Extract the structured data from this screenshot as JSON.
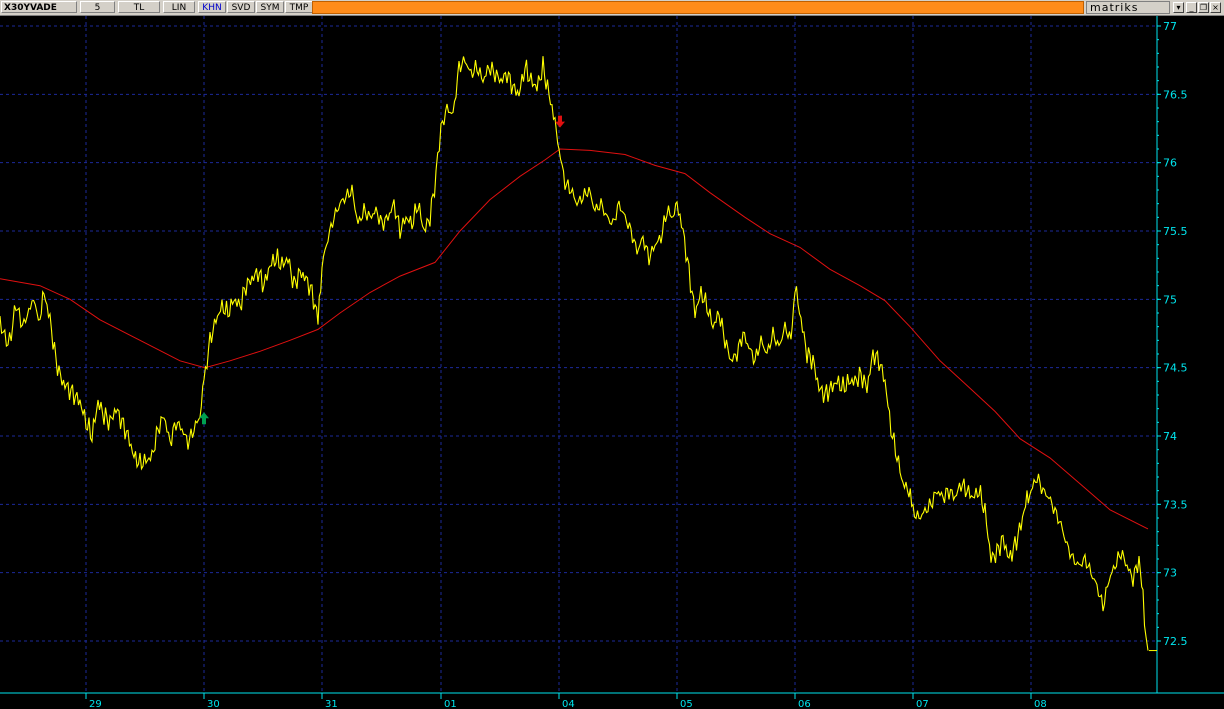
{
  "toolbar": {
    "symbol": "X30YVADE",
    "period": "5",
    "currency": "TL",
    "scale": "LIN",
    "khn": "KHN",
    "svd": "SVD",
    "sym": "SYM",
    "tmp": "TMP",
    "brand": "matriks"
  },
  "window_controls": {
    "dropdown_icon": "chevron-down-icon",
    "minimize_icon": "minimize-icon",
    "restore_icon": "restore-icon",
    "close_icon": "close-icon"
  },
  "colors": {
    "background": "#000000",
    "grid": "#1c2a9a",
    "axis_text": "#00e5ee",
    "price_line": "#ffff00",
    "moving_average": "#e01010",
    "buy_arrow": "#00a050",
    "sell_arrow": "#e01010",
    "toolbar_accent": "#ff8c1a"
  },
  "chart_data": {
    "type": "line",
    "ylim": [
      72.2,
      77.1
    ],
    "yticks": [
      77,
      76.5,
      76,
      75.5,
      75,
      74.5,
      74,
      73.5,
      73,
      72.5
    ],
    "xlim": [
      0,
      1148
    ],
    "x_day_boundaries": [
      86,
      204,
      322,
      441,
      559,
      677,
      795,
      913,
      1031
    ],
    "x_tick_labels": [
      "29",
      "30",
      "31",
      "01",
      "04",
      "05",
      "06",
      "07",
      "08"
    ],
    "last_price": 72.43,
    "series": [
      {
        "type": "price",
        "points": [
          [
            0,
            74.85
          ],
          [
            8,
            74.65
          ],
          [
            16,
            74.95
          ],
          [
            24,
            74.8
          ],
          [
            32,
            75.0
          ],
          [
            40,
            74.85
          ],
          [
            44,
            75.05
          ],
          [
            50,
            74.85
          ],
          [
            56,
            74.55
          ],
          [
            62,
            74.4
          ],
          [
            68,
            74.35
          ],
          [
            74,
            74.3
          ],
          [
            80,
            74.25
          ],
          [
            86,
            74.1
          ],
          [
            92,
            74.0
          ],
          [
            98,
            74.25
          ],
          [
            104,
            74.15
          ],
          [
            110,
            74.1
          ],
          [
            116,
            74.2
          ],
          [
            122,
            74.1
          ],
          [
            128,
            74.0
          ],
          [
            134,
            73.85
          ],
          [
            140,
            73.8
          ],
          [
            146,
            73.82
          ],
          [
            152,
            73.85
          ],
          [
            158,
            74.05
          ],
          [
            164,
            74.15
          ],
          [
            170,
            73.95
          ],
          [
            176,
            74.1
          ],
          [
            182,
            74.05
          ],
          [
            188,
            73.95
          ],
          [
            194,
            74.05
          ],
          [
            200,
            74.15
          ],
          [
            204,
            74.4
          ],
          [
            210,
            74.7
          ],
          [
            216,
            74.85
          ],
          [
            222,
            74.95
          ],
          [
            228,
            74.9
          ],
          [
            234,
            75.0
          ],
          [
            240,
            74.95
          ],
          [
            246,
            75.1
          ],
          [
            252,
            75.15
          ],
          [
            258,
            75.2
          ],
          [
            264,
            75.1
          ],
          [
            270,
            75.25
          ],
          [
            276,
            75.3
          ],
          [
            282,
            75.25
          ],
          [
            288,
            75.3
          ],
          [
            294,
            75.1
          ],
          [
            300,
            75.2
          ],
          [
            306,
            75.15
          ],
          [
            312,
            75.05
          ],
          [
            318,
            74.85
          ],
          [
            322,
            75.25
          ],
          [
            328,
            75.45
          ],
          [
            334,
            75.6
          ],
          [
            340,
            75.7
          ],
          [
            346,
            75.75
          ],
          [
            352,
            75.8
          ],
          [
            358,
            75.55
          ],
          [
            364,
            75.65
          ],
          [
            370,
            75.6
          ],
          [
            376,
            75.65
          ],
          [
            382,
            75.55
          ],
          [
            388,
            75.6
          ],
          [
            394,
            75.7
          ],
          [
            400,
            75.5
          ],
          [
            406,
            75.6
          ],
          [
            412,
            75.55
          ],
          [
            418,
            75.7
          ],
          [
            424,
            75.5
          ],
          [
            430,
            75.6
          ],
          [
            436,
            75.9
          ],
          [
            441,
            76.25
          ],
          [
            447,
            76.4
          ],
          [
            453,
            76.35
          ],
          [
            459,
            76.7
          ],
          [
            465,
            76.75
          ],
          [
            471,
            76.65
          ],
          [
            477,
            76.7
          ],
          [
            483,
            76.6
          ],
          [
            489,
            76.7
          ],
          [
            495,
            76.65
          ],
          [
            501,
            76.6
          ],
          [
            507,
            76.65
          ],
          [
            513,
            76.55
          ],
          [
            519,
            76.5
          ],
          [
            525,
            76.7
          ],
          [
            531,
            76.6
          ],
          [
            537,
            76.55
          ],
          [
            543,
            76.7
          ],
          [
            549,
            76.5
          ],
          [
            555,
            76.3
          ],
          [
            559,
            76.1
          ],
          [
            565,
            75.85
          ],
          [
            571,
            75.8
          ],
          [
            577,
            75.7
          ],
          [
            583,
            75.75
          ],
          [
            589,
            75.8
          ],
          [
            595,
            75.65
          ],
          [
            601,
            75.7
          ],
          [
            607,
            75.6
          ],
          [
            613,
            75.55
          ],
          [
            619,
            75.7
          ],
          [
            625,
            75.6
          ],
          [
            631,
            75.5
          ],
          [
            637,
            75.35
          ],
          [
            643,
            75.45
          ],
          [
            649,
            75.3
          ],
          [
            655,
            75.4
          ],
          [
            661,
            75.45
          ],
          [
            667,
            75.65
          ],
          [
            673,
            75.6
          ],
          [
            677,
            75.7
          ],
          [
            683,
            75.5
          ],
          [
            689,
            75.2
          ],
          [
            695,
            74.9
          ],
          [
            701,
            75.05
          ],
          [
            707,
            74.95
          ],
          [
            713,
            74.8
          ],
          [
            719,
            74.9
          ],
          [
            725,
            74.7
          ],
          [
            731,
            74.55
          ],
          [
            737,
            74.6
          ],
          [
            743,
            74.75
          ],
          [
            749,
            74.65
          ],
          [
            755,
            74.55
          ],
          [
            761,
            74.7
          ],
          [
            767,
            74.6
          ],
          [
            773,
            74.75
          ],
          [
            779,
            74.65
          ],
          [
            785,
            74.8
          ],
          [
            791,
            74.7
          ],
          [
            795,
            75.1
          ],
          [
            801,
            74.85
          ],
          [
            807,
            74.6
          ],
          [
            813,
            74.55
          ],
          [
            819,
            74.35
          ],
          [
            825,
            74.3
          ],
          [
            831,
            74.35
          ],
          [
            837,
            74.4
          ],
          [
            843,
            74.35
          ],
          [
            849,
            74.4
          ],
          [
            855,
            74.4
          ],
          [
            861,
            74.45
          ],
          [
            867,
            74.35
          ],
          [
            873,
            74.6
          ],
          [
            879,
            74.55
          ],
          [
            885,
            74.4
          ],
          [
            891,
            74.05
          ],
          [
            897,
            73.85
          ],
          [
            903,
            73.65
          ],
          [
            909,
            73.6
          ],
          [
            913,
            73.45
          ],
          [
            919,
            73.4
          ],
          [
            925,
            73.45
          ],
          [
            931,
            73.5
          ],
          [
            937,
            73.6
          ],
          [
            943,
            73.55
          ],
          [
            949,
            73.6
          ],
          [
            955,
            73.55
          ],
          [
            961,
            73.65
          ],
          [
            967,
            73.6
          ],
          [
            973,
            73.55
          ],
          [
            979,
            73.6
          ],
          [
            985,
            73.45
          ],
          [
            991,
            73.1
          ],
          [
            997,
            73.15
          ],
          [
            1003,
            73.25
          ],
          [
            1009,
            73.1
          ],
          [
            1015,
            73.2
          ],
          [
            1021,
            73.35
          ],
          [
            1027,
            73.55
          ],
          [
            1031,
            73.6
          ],
          [
            1037,
            73.7
          ],
          [
            1043,
            73.6
          ],
          [
            1049,
            73.55
          ],
          [
            1055,
            73.45
          ],
          [
            1061,
            73.35
          ],
          [
            1067,
            73.2
          ],
          [
            1073,
            73.1
          ],
          [
            1079,
            73.05
          ],
          [
            1085,
            73.1
          ],
          [
            1091,
            73.0
          ],
          [
            1097,
            72.9
          ],
          [
            1103,
            72.75
          ],
          [
            1109,
            72.95
          ],
          [
            1115,
            73.05
          ],
          [
            1121,
            73.15
          ],
          [
            1127,
            73.05
          ],
          [
            1133,
            72.95
          ],
          [
            1139,
            73.1
          ],
          [
            1143,
            72.8
          ],
          [
            1146,
            72.55
          ],
          [
            1148,
            72.43
          ]
        ]
      },
      {
        "type": "moving_average",
        "points": [
          [
            0,
            75.15
          ],
          [
            40,
            75.1
          ],
          [
            70,
            75.0
          ],
          [
            100,
            74.85
          ],
          [
            140,
            74.7
          ],
          [
            180,
            74.55
          ],
          [
            205,
            74.5
          ],
          [
            230,
            74.55
          ],
          [
            260,
            74.62
          ],
          [
            290,
            74.7
          ],
          [
            318,
            74.78
          ],
          [
            340,
            74.9
          ],
          [
            370,
            75.05
          ],
          [
            400,
            75.17
          ],
          [
            435,
            75.27
          ],
          [
            460,
            75.5
          ],
          [
            490,
            75.73
          ],
          [
            520,
            75.9
          ],
          [
            545,
            76.02
          ],
          [
            560,
            76.1
          ],
          [
            590,
            76.09
          ],
          [
            625,
            76.06
          ],
          [
            655,
            75.98
          ],
          [
            685,
            75.92
          ],
          [
            710,
            75.78
          ],
          [
            745,
            75.6
          ],
          [
            770,
            75.48
          ],
          [
            800,
            75.38
          ],
          [
            830,
            75.22
          ],
          [
            860,
            75.1
          ],
          [
            885,
            74.99
          ],
          [
            910,
            74.8
          ],
          [
            940,
            74.55
          ],
          [
            970,
            74.35
          ],
          [
            995,
            74.18
          ],
          [
            1020,
            73.98
          ],
          [
            1050,
            73.84
          ],
          [
            1080,
            73.65
          ],
          [
            1110,
            73.46
          ],
          [
            1148,
            73.32
          ]
        ]
      }
    ],
    "signals": [
      {
        "type": "buy",
        "x": 204,
        "y": 74.13
      },
      {
        "type": "sell",
        "x": 560,
        "y": 76.3
      }
    ]
  }
}
